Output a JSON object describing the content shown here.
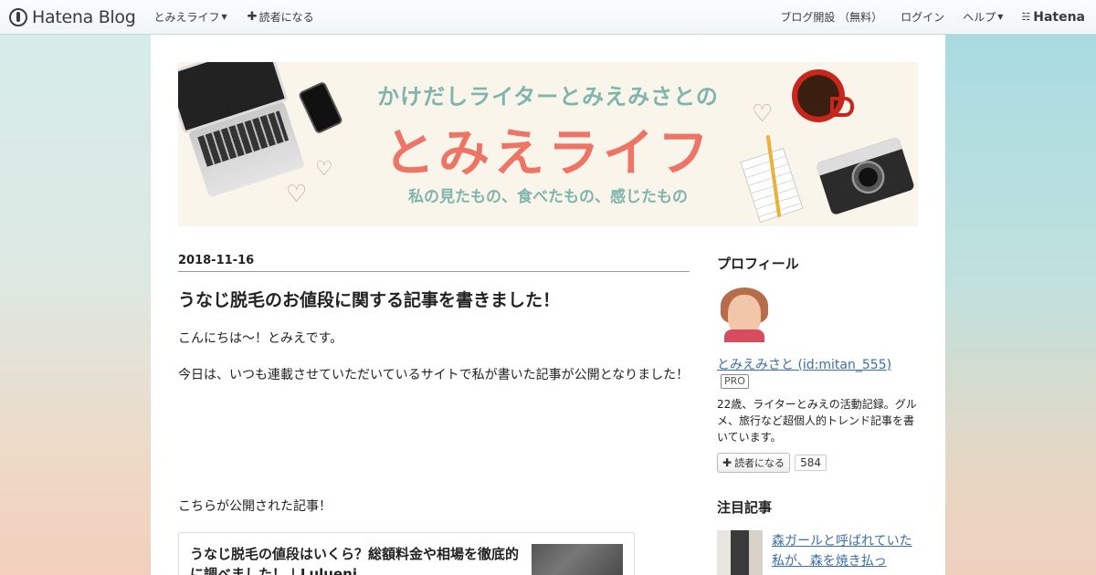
{
  "topbar": {
    "brand": "Hatena Blog",
    "blog_menu": "とみえライフ",
    "subscribe": "読者になる",
    "create_blog": "ブログ開設 （無料）",
    "login": "ログイン",
    "help": "ヘルプ",
    "hatena": "Hatena"
  },
  "banner": {
    "subtitle": "かけだしライターとみえみさとの",
    "title": "とみえライフ",
    "tagline": "私の見たもの、食べたもの、感じたもの"
  },
  "entry": {
    "date": "2018-11-16",
    "title": "うなじ脱毛のお値段に関する記事を書きました！",
    "p1": "こんにちは〜！とみえです。",
    "p2": "今日は、いつも連載させていただいているサイトで私が書いた記事が公開となりました！",
    "p3": "こちらが公開された記事！",
    "embed_title": "うなじ脱毛の値段はいくら？総額料金や相場を徹底的に調べました！ | Lulueni"
  },
  "sidebar": {
    "profile_heading": "プロフィール",
    "profile_name": "とみえみさと (id:mitan_555)",
    "pro": "PRO",
    "desc": "22歳、ライターとみえの活動記録。グルメ、旅行など超個人的トレンド記事を書いています。",
    "subscribe_label": "読者になる",
    "subscribe_count": "584",
    "featured_heading": "注目記事",
    "featured_1": "森ガールと呼ばれていた私が、森を焼き払っ"
  }
}
